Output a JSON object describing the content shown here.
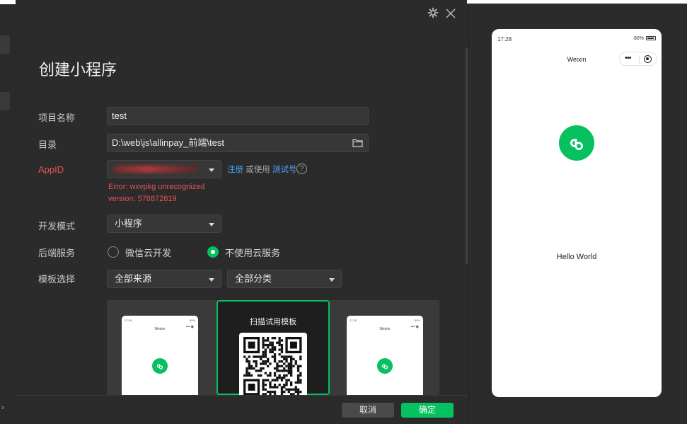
{
  "colors": {
    "accent": "#07c160",
    "error": "#e55353",
    "link": "#4aa3ff",
    "background": "#2b2b2b"
  },
  "dialog": {
    "title": "创建小程序",
    "form": {
      "project_name": {
        "label": "项目名称",
        "value": "test"
      },
      "directory": {
        "label": "目录",
        "value": "D:\\web\\js\\allinpay_前端\\test",
        "icon": "folder-icon"
      },
      "appid": {
        "label": "AppID",
        "register_link": "注册",
        "or_use_text": "或使用",
        "test_link": "测试号",
        "error_line1": "Error: wxvpkg unrecognized",
        "error_line2": "version: 576872819"
      },
      "dev_mode": {
        "label": "开发模式",
        "value": "小程序"
      },
      "backend": {
        "label": "后端服务",
        "options": [
          {
            "label": "微信云开发",
            "selected": false
          },
          {
            "label": "不使用云服务",
            "selected": true
          }
        ]
      },
      "template": {
        "label": "模板选择",
        "source_value": "全部来源",
        "category_value": "全部分类"
      }
    },
    "gallery": {
      "card_time": "17:28",
      "card_battery": "80%",
      "card_title": "Weixin",
      "scan_label": "扫描试用模板"
    },
    "footer": {
      "cancel_label": "取消",
      "ok_label": "确定"
    }
  },
  "preview": {
    "time": "17:28",
    "battery": "80%",
    "nav_title": "Weixin",
    "body_text": "Hello World"
  }
}
